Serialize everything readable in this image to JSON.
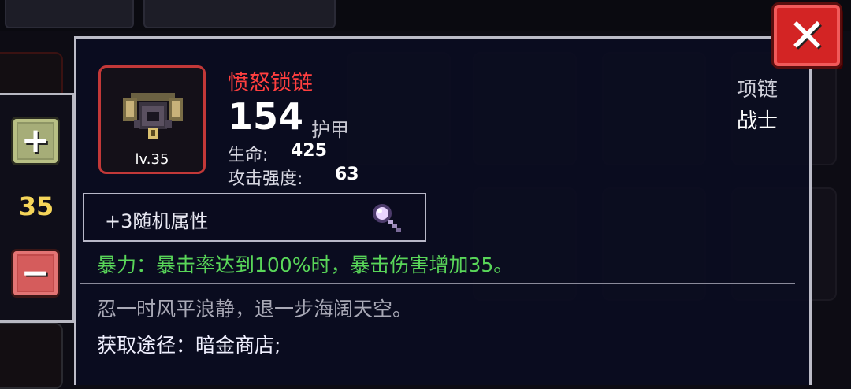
{
  "side_panel": {
    "plus_glyph": "+",
    "minus_glyph": "−",
    "level_value": "35"
  },
  "close_glyph": "✕",
  "item": {
    "name": "愤怒锁链",
    "level_label": "lv.35",
    "value": "154",
    "value_label": "护甲",
    "stats": [
      {
        "label": "生命:",
        "value": "425"
      },
      {
        "label": "攻击强度:",
        "value": "63"
      }
    ],
    "type": "项链",
    "class": "战士",
    "random_attr": "+3随机属性",
    "skill": "暴力：暴击率达到100%时，暴击伤害增加35。",
    "flavor": "忍一时风平浪静，退一步海阔天空。",
    "source": "获取途径：暗金商店;"
  },
  "colors": {
    "name": "#ff3f3f",
    "skill": "#59d659",
    "level": "#f5d55a",
    "close": "#d32424"
  }
}
